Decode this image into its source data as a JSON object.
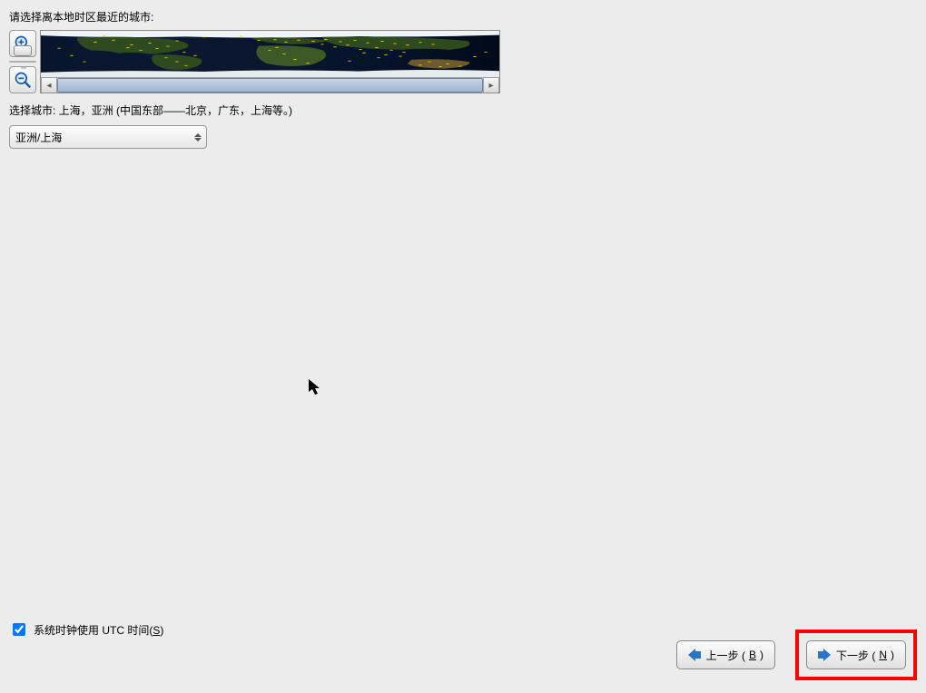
{
  "prompt": "请选择离本地时区最近的城市:",
  "map": {
    "selected_city_display": "上海",
    "selected_marker": "X"
  },
  "selected_row": {
    "label": "选择城市: ",
    "value": "上海，亚洲 (中国东部——北京，广东，上海等。)"
  },
  "timezone_select": {
    "value": "亚洲/上海"
  },
  "utc_checkbox": {
    "checked": true,
    "label_pre": "系统时钟使用 UTC 时间(",
    "hotkey": "S",
    "label_post": ")"
  },
  "buttons": {
    "back_pre": "上一步 (",
    "back_hotkey": "B",
    "back_post": ")",
    "next_pre": "下一步 (",
    "next_hotkey": "N",
    "next_post": ")"
  }
}
